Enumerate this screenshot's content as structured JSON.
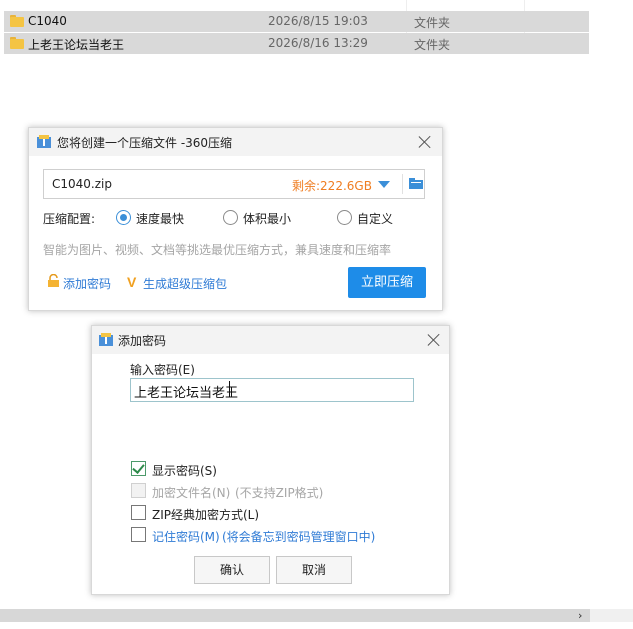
{
  "file_list": {
    "rows": [
      {
        "name": "C1040",
        "date": "2026/8/15 19:03",
        "type": "文件夹"
      },
      {
        "name": "上老王论坛当老王",
        "date": "2026/8/16 13:29",
        "type": "文件夹"
      }
    ]
  },
  "compress_dialog": {
    "title": "您将创建一个压缩文件 -360压缩",
    "filename": "C1040.zip",
    "free_space": "剩余:222.6GB",
    "config_label": "压缩配置:",
    "options": [
      {
        "label": "速度最快",
        "selected": true
      },
      {
        "label": "体积最小",
        "selected": false
      },
      {
        "label": "自定义",
        "selected": false
      }
    ],
    "hint": "智能为图片、视频、文档等挑选最优压缩方式，兼具速度和压缩率",
    "add_password_label": "添加密码",
    "super_pack_label": "生成超级压缩包",
    "compress_button": "立即压缩",
    "accent_color": "#1e8ce8"
  },
  "password_dialog": {
    "title": "添加密码",
    "input_label": "输入密码(E)",
    "password_value": "上老王论坛当老王",
    "checkboxes": [
      {
        "label": "显示密码(S)",
        "checked": true,
        "enabled": true,
        "note": ""
      },
      {
        "label": "加密文件名(N)",
        "checked": false,
        "enabled": false,
        "note": "(不支持ZIP格式)"
      },
      {
        "label": "ZIP经典加密方式(L)",
        "checked": false,
        "enabled": true,
        "note": ""
      },
      {
        "label": "记住密码(M)",
        "checked": false,
        "enabled": true,
        "note": "(将会备忘到密码管理窗口中)"
      }
    ],
    "ok_button": "确认",
    "cancel_button": "取消"
  },
  "scrollbar": {
    "arrow": "›"
  }
}
